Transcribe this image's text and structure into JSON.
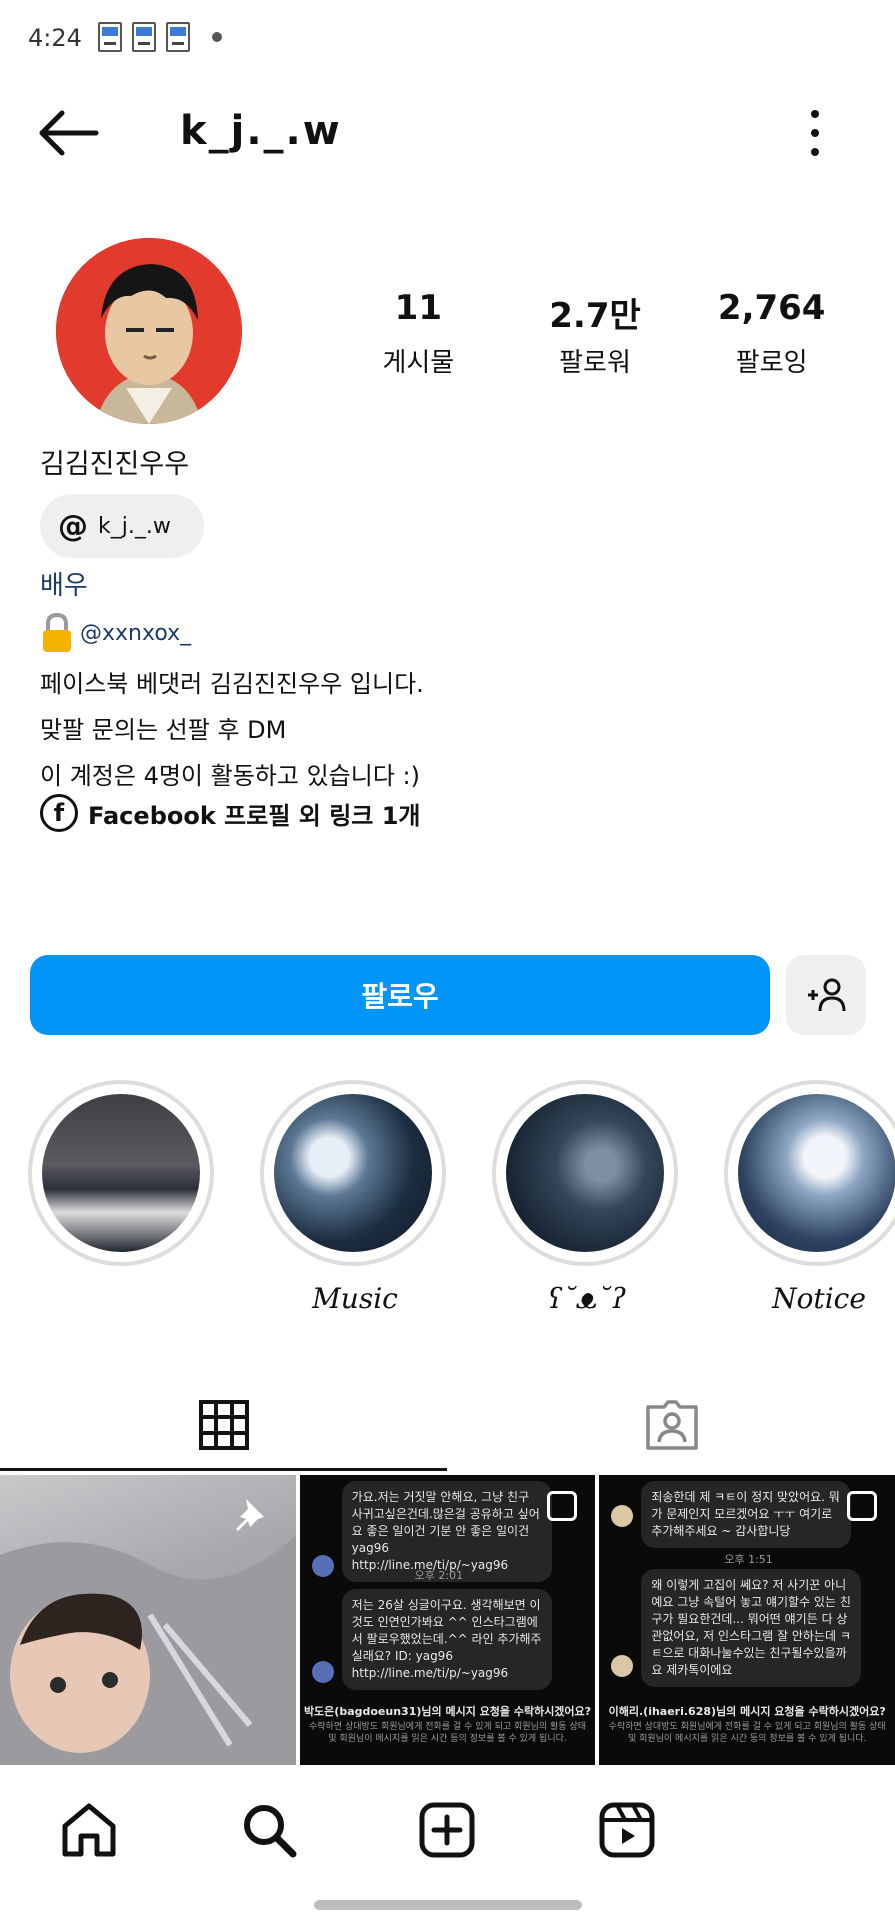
{
  "status_bar": {
    "time": "4:24"
  },
  "header": {
    "username": "k_j._.w"
  },
  "stats": [
    {
      "value": "11",
      "label": "게시물"
    },
    {
      "value": "2.7만",
      "label": "팔로워"
    },
    {
      "value": "2,764",
      "label": "팔로잉"
    }
  ],
  "profile": {
    "display_name": "김김진진우우",
    "threads_handle": "k_j._.w",
    "category": "배우",
    "linked_account": "@xxnxox_",
    "bio": [
      "페이스북 베댓러 김김진진우우 입니다.",
      "맞팔 문의는 선팔 후 DM",
      "이 계정은 4명이 활동하고 있습니다 :)"
    ],
    "facebook_link": "Facebook 프로필 외 링크 1개"
  },
  "actions": {
    "follow_label": "팔로우"
  },
  "highlights": [
    {
      "label": ""
    },
    {
      "label": "Music"
    },
    {
      "label": "ʕ˘ᴥ˘ʔ"
    },
    {
      "label": "Notice"
    }
  ],
  "posts": {
    "post2": {
      "msg1": "가요.저는 거짓말 안해요, 그냥 친구 사귀고싶은건데.많은걸 공유하고 싶어요 좋은 일이건 기분 안 좋은 일이건 yag96 http://line.me/ti/p/~yag96",
      "time": "오후 2:01",
      "msg2": "저는 26살 싱글이구요. 생각해보면 이것도 인연인가봐요 ^^ 인스타그램에서 팔로우했었는데.^^ 라인 추가해주실래요? ID: yag96 http://line.me/ti/p/~yag96",
      "request": "박도은(bagdoeun31)님의 메시지 요청을 수락하시겠어요?",
      "sub": "수락하면 상대방도 회원님에게 전화를 걸 수 있게 되고 회원님의 활동 상태 및 회원님이 메시지를 읽은 시간 등의 정보를 볼 수 있게 됩니다."
    },
    "post3": {
      "msg1": "죄송한데 제 ㅋㅌ이 정지 맞았어요. 뭐가 문제인지 모르겠어요 ㅜㅜ 여기로추가해주세요 ~ 감사합니당",
      "time": "오후 1:51",
      "msg2": "왜 이렇게 고집이 쎄요? 저 사기꾼 아니예요 그냥 속털어 놓고 얘기할수 있는 친구가 필요한건데... 뭐어떤 얘기든 다 상관없어요, 저 인스타그램 잘 안하는데 ㅋㅌ으로 대화나눌수있는 친구될수있을까요 제카톡이에요",
      "request": "이해리.(ihaeri.628)님의 메시지 요청을 수락하시겠어요?",
      "sub": "수락하면 상대방도 회원님에게 전화를 걸 수 있게 되고 회원님의 활동 상태 및 회원님이 메시지를 읽은 시간 등의 정보를 볼 수 있게 됩니다."
    }
  }
}
